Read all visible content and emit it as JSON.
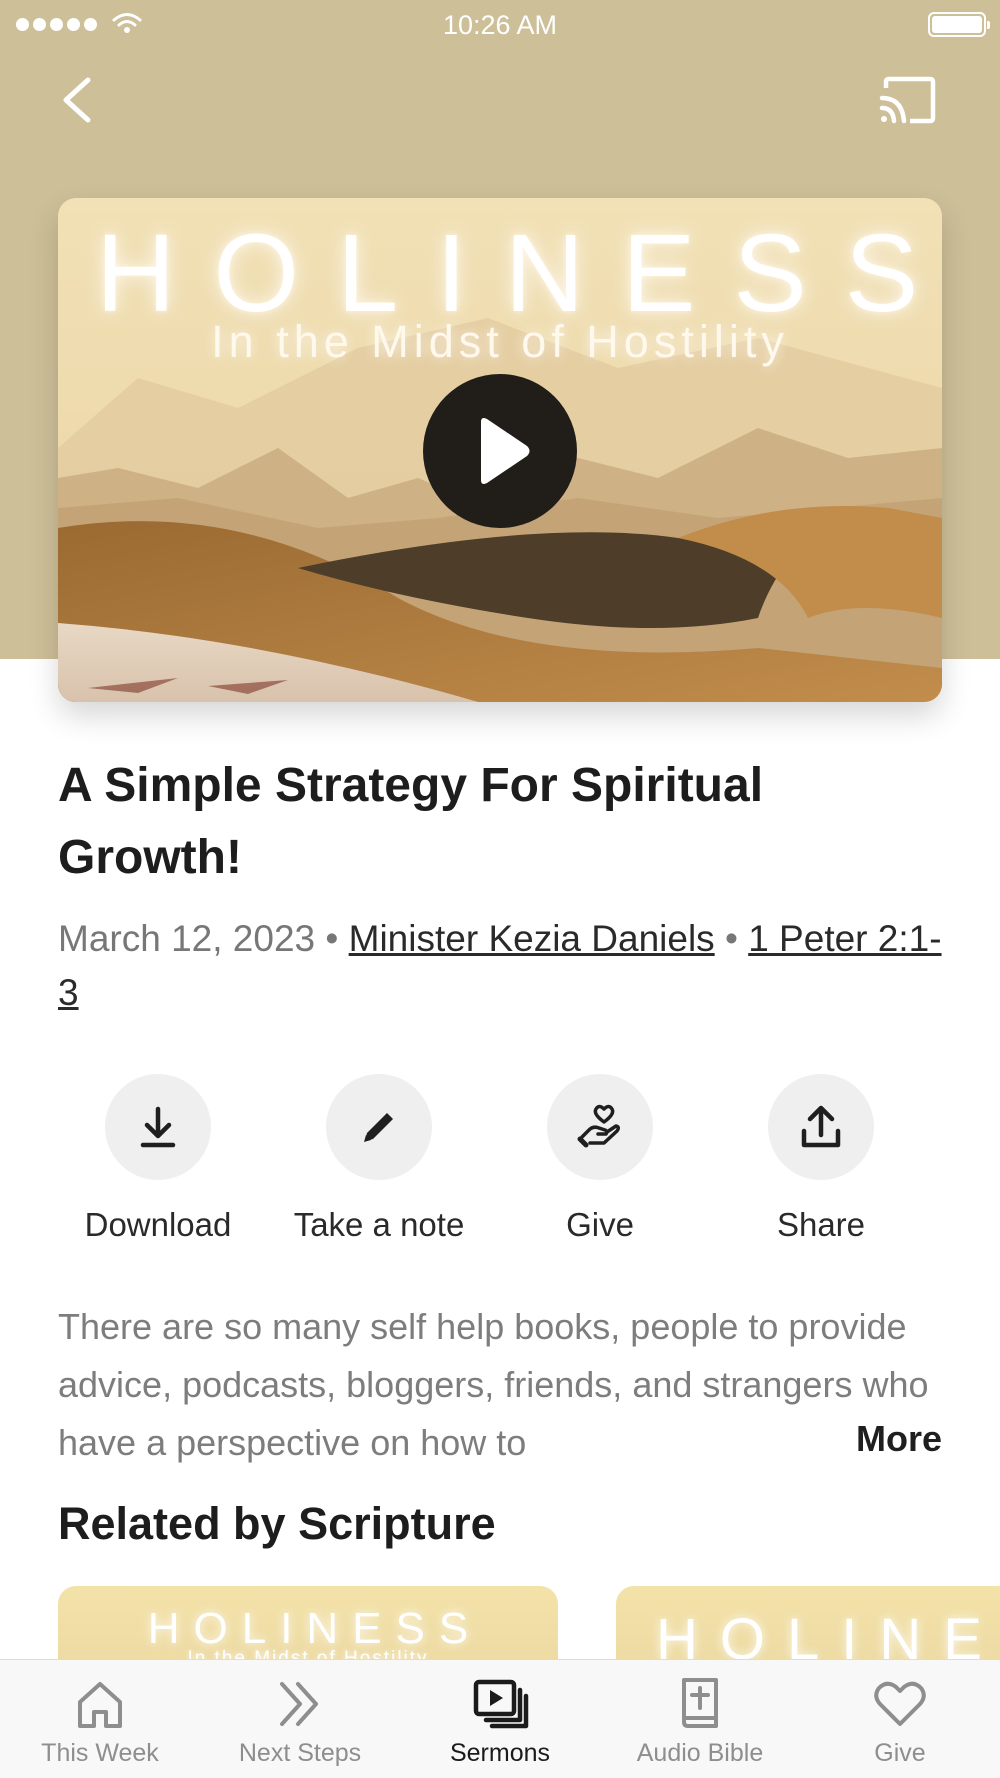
{
  "status_bar": {
    "time": "10:26 AM"
  },
  "artwork": {
    "title": "HOLINESS",
    "subtitle": "In the Midst of Hostility"
  },
  "sermon": {
    "title": "A Simple Strategy For Spiritual Growth!",
    "date": "March 12, 2023",
    "separator": "•",
    "speaker": "Minister Kezia Daniels",
    "scripture": "1 Peter 2:1-3"
  },
  "actions": [
    {
      "label": "Download",
      "icon": "download-icon"
    },
    {
      "label": "Take a note",
      "icon": "pencil-icon"
    },
    {
      "label": "Give",
      "icon": "giving-hand-heart-icon"
    },
    {
      "label": "Share",
      "icon": "share-icon"
    }
  ],
  "description": {
    "text": "There are so many self help books, people to provide advice, podcasts, bloggers, friends, and strangers who have a perspective on how to",
    "more_label": "More"
  },
  "related": {
    "heading": "Related by Scripture",
    "cards": [
      {
        "title": "HOLINESS",
        "subtitle": "In the Midst of Hostility"
      },
      {
        "title": "HOLINES"
      }
    ]
  },
  "tab_bar": {
    "active": "Sermons",
    "tabs": [
      {
        "label": "This Week",
        "icon": "home-icon"
      },
      {
        "label": "Next Steps",
        "icon": "double-chevron-right-icon"
      },
      {
        "label": "Sermons",
        "icon": "video-stack-icon"
      },
      {
        "label": "Audio Bible",
        "icon": "bible-icon"
      },
      {
        "label": "Give",
        "icon": "heart-icon"
      }
    ]
  },
  "colors": {
    "hero_background": "#cdbf98",
    "play_button": "#211d19",
    "action_circle": "#efefef",
    "tab_active": "#1b1b1b",
    "tab_inactive": "#8e8e8e"
  }
}
